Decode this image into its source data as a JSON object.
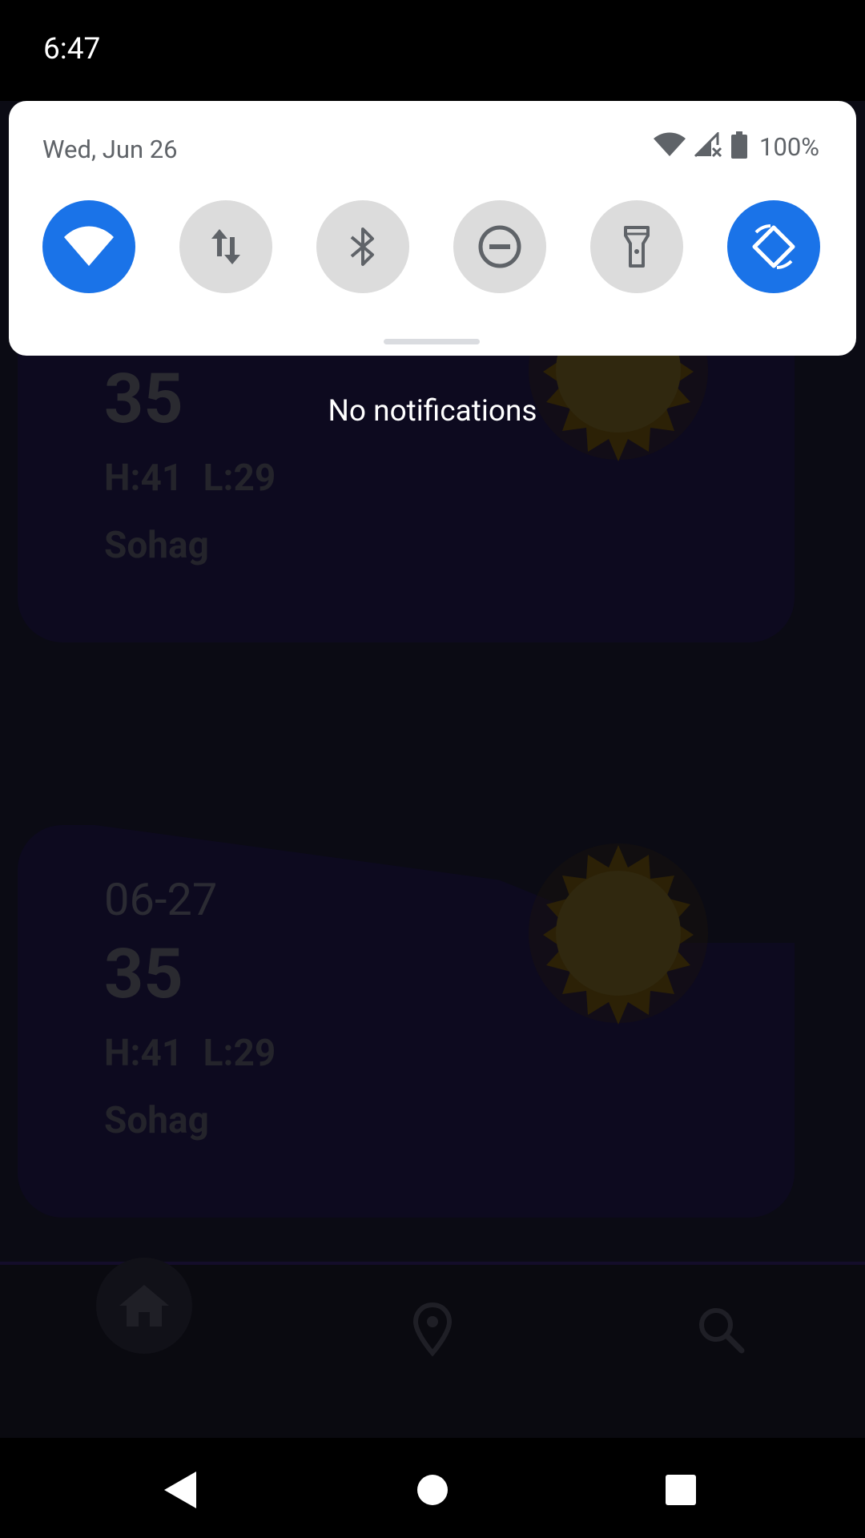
{
  "status_bar": {
    "time": "6:47"
  },
  "quick_settings": {
    "date": "Wed, Jun 26",
    "battery_percent": "100%",
    "tiles": [
      {
        "name": "wifi",
        "icon": "wifi-icon",
        "state": "on"
      },
      {
        "name": "mobile-data",
        "icon": "data-arrows-icon",
        "state": "off"
      },
      {
        "name": "bluetooth",
        "icon": "bluetooth-icon",
        "state": "off"
      },
      {
        "name": "do-not-disturb",
        "icon": "dnd-icon",
        "state": "off"
      },
      {
        "name": "flashlight",
        "icon": "flashlight-icon",
        "state": "off"
      },
      {
        "name": "auto-rotate",
        "icon": "rotate-icon",
        "state": "on"
      }
    ],
    "accent_color": "#1a73e8"
  },
  "notifications": {
    "empty_text": "No notifications"
  },
  "app": {
    "cards": [
      {
        "date": "",
        "temp": "35",
        "hl": "H:41 L:29",
        "city": "Sohag"
      },
      {
        "date": "06-27",
        "temp": "35",
        "hl": "H:41 L:29",
        "city": "Sohag"
      }
    ],
    "bottom_nav": [
      "home-icon",
      "location-icon",
      "search-icon"
    ]
  },
  "system_nav": [
    "back-icon",
    "home-circle-icon",
    "recents-icon"
  ]
}
